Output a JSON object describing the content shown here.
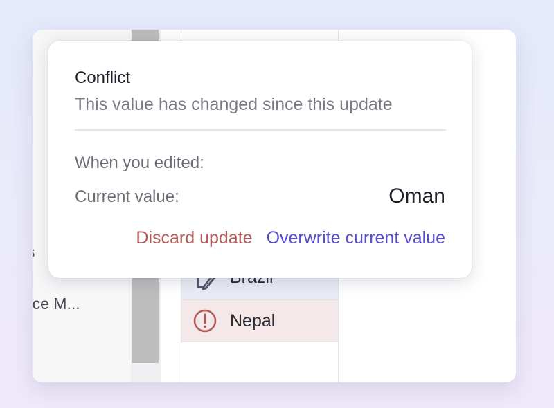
{
  "background_table": {
    "left_column_fragments": [
      "s",
      "rce M..."
    ],
    "rows": [
      {
        "label": "Brazil",
        "icon": "pencil-edit-icon"
      },
      {
        "label": "Nepal",
        "icon": "alert-circle-icon"
      }
    ]
  },
  "popover": {
    "title": "Conflict",
    "subtitle": "This value has changed since this update",
    "edited_label": "When you edited:",
    "current_label": "Current value:",
    "current_value": "Oman",
    "discard_label": "Discard update",
    "overwrite_label": "Overwrite current value"
  },
  "colors": {
    "discard": "#b35a5a",
    "overwrite": "#5a4ccf",
    "alert_icon": "#b35a5a",
    "row_brazil_bg": "#e9ebf5",
    "row_nepal_bg": "#f5e8e8"
  }
}
